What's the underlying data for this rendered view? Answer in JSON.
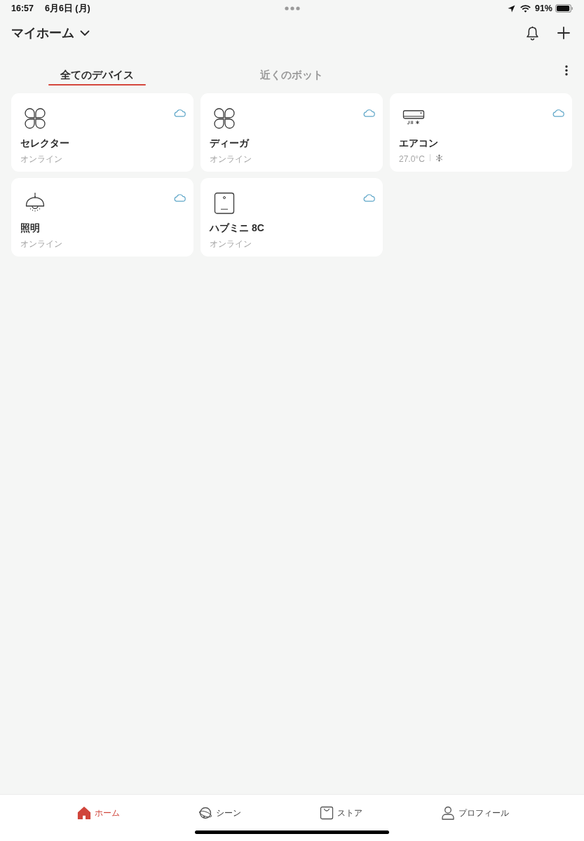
{
  "status_bar": {
    "time": "16:57",
    "date": "6月6日 (月)",
    "battery": "91%"
  },
  "header": {
    "title": "マイホーム"
  },
  "tabs": [
    {
      "label": "全てのデバイス",
      "selected": true
    },
    {
      "label": "近くのボット",
      "selected": false
    }
  ],
  "devices": [
    {
      "kind": "bot",
      "name": "セレクター",
      "status": "オンライン",
      "cloud": true
    },
    {
      "kind": "bot",
      "name": "ディーガ",
      "status": "オンライン",
      "cloud": true
    },
    {
      "kind": "aircon",
      "name": "エアコン",
      "status": "27.0°C",
      "cloud": true
    },
    {
      "kind": "light",
      "name": "照明",
      "status": "オンライン",
      "cloud": true
    },
    {
      "kind": "hub",
      "name": "ハブミニ 8C",
      "status": "オンライン",
      "cloud": true
    }
  ],
  "bottom_nav": [
    {
      "kind": "home",
      "label": "ホーム",
      "selected": true
    },
    {
      "kind": "scene",
      "label": "シーン",
      "selected": false
    },
    {
      "kind": "store",
      "label": "ストア",
      "selected": false
    },
    {
      "kind": "profile",
      "label": "プロフィール",
      "selected": false
    }
  ]
}
